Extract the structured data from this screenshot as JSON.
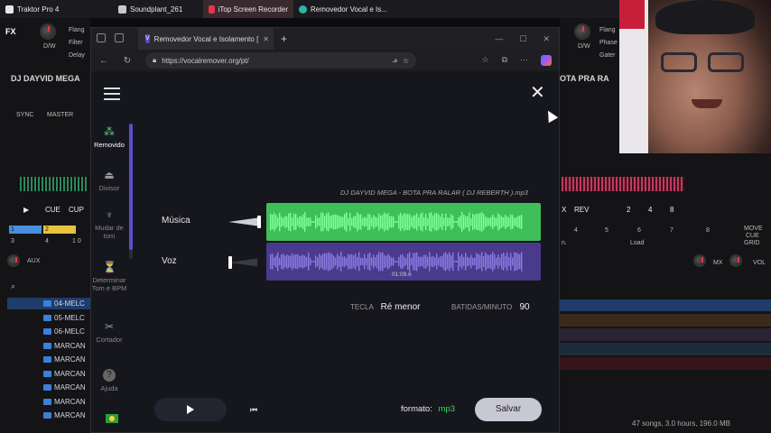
{
  "taskbar": {
    "items": [
      "Traktor Pro 4",
      "Soundplant_261",
      "iTop Screen Recorder",
      "Removedor Vocal e Is..."
    ]
  },
  "traktor": {
    "deck_a_title": "DJ DAYVID MEGA",
    "deck_b_title": "OTA PRA RA",
    "sync": "SYNC",
    "master": "MASTER",
    "fx_label": "FX",
    "flanger": "Flang",
    "filter": "Filter",
    "delay": "Delay",
    "dw": "D/W",
    "phase": "Phase",
    "gater": "Gater",
    "cue": "CUE",
    "cup": "CUP",
    "x_label": "X",
    "rev": "REV",
    "beat_nums": [
      "2",
      "4",
      "8"
    ],
    "pad_nums": [
      "1",
      "2",
      "3",
      "4"
    ],
    "bot_nums": [
      "4",
      "5",
      "6",
      "7",
      "8"
    ],
    "load": "Load",
    "move": "MOVE",
    "cue_btn": "CUE",
    "grid": "GRID",
    "aux": "AUX",
    "mx": "MX",
    "vol": "VOL",
    "time_small": "1 0",
    "n_label": "n.",
    "folders": [
      "04-MELC",
      "05-MELC",
      "06-MELC",
      "MARCAN",
      "MARCAN",
      "MARCAN",
      "MARCAN",
      "MARCAN",
      "MARCAN"
    ],
    "status": "47 songs, 3.0 hours, 196.0 MB"
  },
  "browser": {
    "tab_title": "Removedor Vocal e Isolamento [",
    "tab_icon": "V",
    "url": "https://vocalremover.org/pt/",
    "page": {
      "sidebar": [
        {
          "label": "Removido",
          "icon": "vocal-remover-icon"
        },
        {
          "label": "Divisor",
          "icon": "splitter-icon"
        },
        {
          "label": "Mudar de tom",
          "icon": "pitch-icon"
        },
        {
          "label": "Determinar Tom e BPM",
          "icon": "key-bpm-icon"
        },
        {
          "label": "Cortador",
          "icon": "scissors-icon"
        },
        {
          "label": "Ajuda",
          "icon": "help-icon"
        }
      ],
      "song_title": "DJ DAYVID MEGA - BOTA PRA RALAR ( DJ REBERTH ).mp3",
      "tracks": [
        {
          "label": "Música",
          "volume": 1.0,
          "color": "#3fbf5a",
          "wave_color": "#7dff9a"
        },
        {
          "label": "Voz",
          "volume": 0.0,
          "color": "#4a3a8c",
          "wave_color": "#8a7ae0"
        }
      ],
      "time_marker": "01:09.6",
      "key_label": "TECLA",
      "key_value": "Ré menor",
      "bpm_label": "BATIDAS/MINUTO",
      "bpm_value": "90",
      "format_label": "formato:",
      "format_value": "mp3",
      "save_label": "Salvar"
    }
  }
}
